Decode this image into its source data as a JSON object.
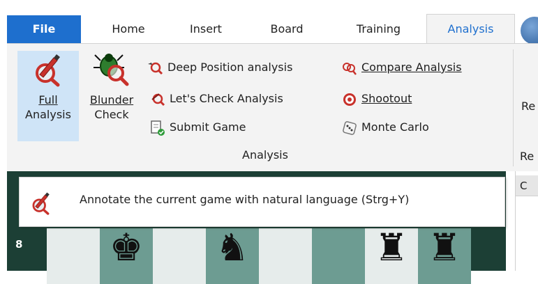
{
  "tabs": [
    {
      "label": "File"
    },
    {
      "label": "Home"
    },
    {
      "label": "Insert"
    },
    {
      "label": "Board"
    },
    {
      "label": "Training"
    },
    {
      "label": "Analysis"
    }
  ],
  "ribbon": {
    "full_analysis": {
      "line1": "Full",
      "line2": "Analysis"
    },
    "blunder_check": {
      "line1": "Blunder",
      "line2": "Check"
    },
    "deep_position": "Deep Position analysis",
    "lets_check": "Let's Check Analysis",
    "submit_game": "Submit Game",
    "compare_analysis": "Compare Analysis",
    "shootout": "Shootout",
    "monte_carlo": "Monte Carlo",
    "group_label": "Analysis",
    "edge_label_top": "Re",
    "edge_label_bottom": "Re"
  },
  "tooltip": {
    "text": "Annotate the current game with natural language (Strg+Y)"
  },
  "board": {
    "rank_label": "8"
  },
  "right_panel": {
    "header": "C"
  }
}
